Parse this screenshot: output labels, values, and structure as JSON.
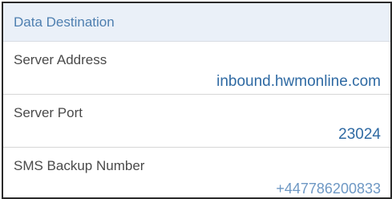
{
  "section": {
    "title": "Data Destination"
  },
  "fields": [
    {
      "label": "Server Address",
      "value": "inbound.hwmonline.com"
    },
    {
      "label": "Server Port",
      "value": "23024"
    },
    {
      "label": "SMS Backup Number",
      "value": "+447786200833"
    }
  ],
  "colors": {
    "header_background": "#eaf0f8",
    "header_text": "#4e7fb0",
    "value_text": "#2f6aa3",
    "label_text": "#4a4a4a"
  }
}
